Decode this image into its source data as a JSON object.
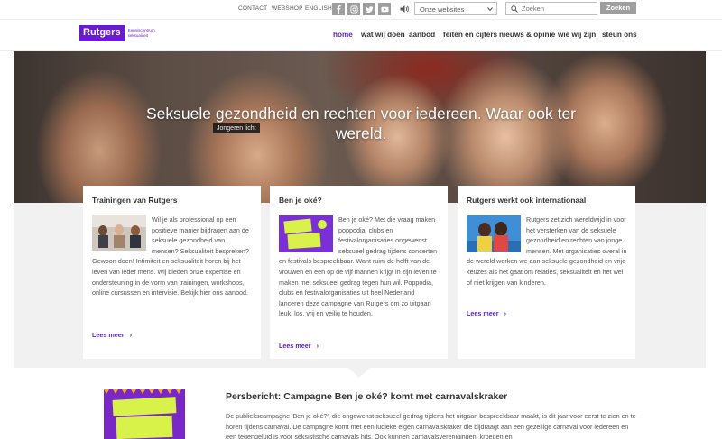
{
  "topbar": {
    "links": [
      "CONTACT",
      "WEBSHOP",
      "ENGLISH"
    ],
    "social_icons": [
      "facebook-icon",
      "instagram-icon",
      "twitter-icon",
      "youtube-icon"
    ],
    "websites_select": "Onze websites",
    "search_placeholder": "Zoeken",
    "search_button": "Zoeken"
  },
  "logo": {
    "name": "Rutgers",
    "subtitle": "Kenniscentrum seksualiteit"
  },
  "nav": {
    "items": [
      "home",
      "wat wij doen",
      "aanbod",
      "feiten en cijfers",
      "nieuws & opinie",
      "wie wij zijn",
      "steun ons"
    ],
    "active": "home"
  },
  "hero": {
    "title": "Seksuele gezondheid en rechten voor iedereen. Waar ook ter wereld.",
    "tag": "Jongeren licht"
  },
  "cards": [
    {
      "title": "Trainingen van Rutgers",
      "text": "Wil je als professional op een positieve manier bijdragen aan de seksuele gezondheid van mensen? Seksualiteit bespreken? Gewoon doen! Intimiteit en seksualiteit horen bij het leven van ieder mens. Wij bieden onze expertise en ondersteuning in de vorm van trainingen, workshops, online cursussen en intervisie. Bekijk hier ons aanbod.",
      "read_more": "Lees meer"
    },
    {
      "title": "Ben je oké?",
      "text": "Ben je oké? Met die vraag maken poppodia, clubs en festivalorganisaties ongewenst seksueel gedrag tijdens concerten en festivals bespreekbaar. Want ruim de helft van de vrouwen en een op de vijf mannen krijgt in zijn leven te maken met seksueel gedrag tegen hun wil. Poppodia, clubs en festivalorganisaties uit heel Nederland lanceren deze campagne van Rutgers om zo uitgaan leuk, los, vrij en veilig te houden.",
      "image_text": "BEN JE OKÉ?",
      "read_more": "Lees meer"
    },
    {
      "title": "Rutgers werkt ook internationaal",
      "text": "Rutgers zet zich wereldwijd in voor het versterken van de seksuele gezondheid en rechten van jonge mensen. Met organisaties overal in de wereld werken we aan seksuele gezondheid en vrije keuzes als het gaat om relaties, seksualiteit en het wel of niet krijgen van kinderen.",
      "read_more": "Lees meer"
    }
  ],
  "press": {
    "title": "Persbericht: Campagne Ben je oké? komt met carnavalskraker",
    "text": "De publiekscampagne 'Ben je oké?', die ongewenst seksueel gedrag tijdens het uitgaan bespreekbaar maakt, is dit jaar voor eerst te zien en te horen tijdens carnaval. De campagne komt met een ludieke eigen carnavalskraker die bijdraagt aan een gezellige carnaval voor iedereen en een tegengeluid is voor seksistische carnavals hits. Ook kunnen carnavalsverenigingen, kroegen en",
    "image_text": "BEN JE OKÉ?"
  },
  "colors": {
    "brand_purple": "#6a1bd0",
    "link_purple": "#5a1fc8",
    "grey_button": "#9e9e9e",
    "section_grey": "#f1f1f1"
  }
}
